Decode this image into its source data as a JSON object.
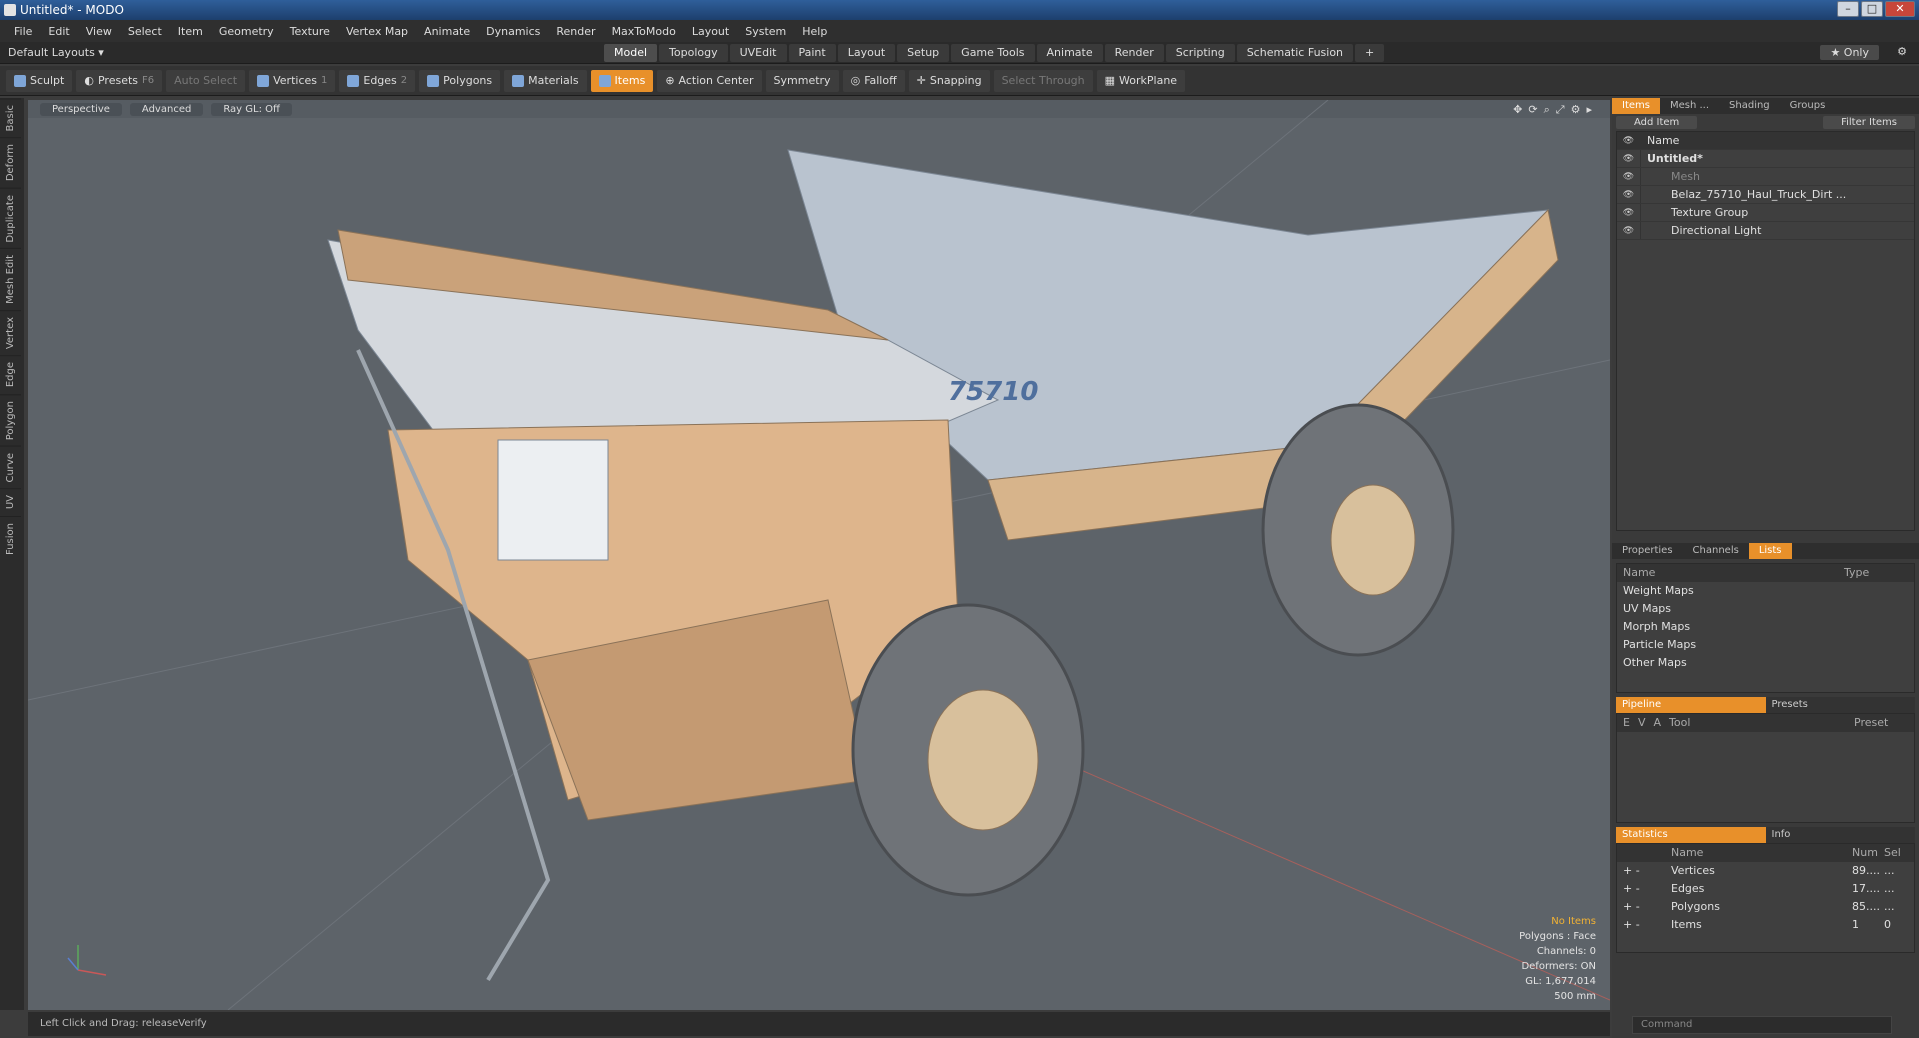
{
  "window": {
    "title": "Untitled* - MODO"
  },
  "menu": [
    "File",
    "Edit",
    "View",
    "Select",
    "Item",
    "Geometry",
    "Texture",
    "Vertex Map",
    "Animate",
    "Dynamics",
    "Render",
    "MaxToModo",
    "Layout",
    "System",
    "Help"
  ],
  "layout": {
    "selector": "Default Layouts ▾",
    "tabs": [
      "Model",
      "Topology",
      "UVEdit",
      "Paint",
      "Layout",
      "Setup",
      "Game Tools",
      "Animate",
      "Render",
      "Scripting",
      "Schematic Fusion"
    ],
    "active_tab": "Model",
    "only": "★ Only"
  },
  "toolbar": {
    "sculpt": "Sculpt",
    "presets": "Presets",
    "presets_key": "F6",
    "auto_select": "Auto Select",
    "vertices": "Vertices",
    "vertices_n": "1",
    "edges": "Edges",
    "edges_n": "2",
    "polygons": "Polygons",
    "materials": "Materials",
    "items": "Items",
    "action_center": "Action Center",
    "symmetry": "Symmetry",
    "falloff": "Falloff",
    "snapping": "Snapping",
    "select_through": "Select Through",
    "workplane": "WorkPlane"
  },
  "left_tabs": [
    "Basic",
    "Deform",
    "Duplicate",
    "Mesh Edit",
    "Vertex",
    "Edge",
    "Polygon",
    "Curve",
    "UV",
    "Fusion"
  ],
  "viewport": {
    "perspective": "Perspective",
    "advanced": "Advanced",
    "raygl": "Ray GL: Off",
    "truck_number": "75710",
    "stats": {
      "no_items": "No Items",
      "polygons": "Polygons : Face",
      "channels": "Channels: 0",
      "deformers": "Deformers: ON",
      "gl": "GL: 1,677,014",
      "scale": "500 mm"
    }
  },
  "status": {
    "hint": "Left Click and Drag:  releaseVerify"
  },
  "items_panel": {
    "tabs": [
      "Items",
      "Mesh ...",
      "Shading",
      "Groups"
    ],
    "add_item": "Add Item",
    "filter": "Filter Items",
    "col_name": "Name",
    "rows": [
      "Untitled*",
      "Mesh",
      "Belaz_75710_Haul_Truck_Dirt ...",
      "Texture Group",
      "Directional Light"
    ]
  },
  "props_panel": {
    "tabs": [
      "Properties",
      "Channels",
      "Lists"
    ],
    "col_name": "Name",
    "col_type": "Type",
    "rows": [
      "Weight Maps",
      "UV Maps",
      "Morph Maps",
      "Particle Maps",
      "Other Maps"
    ]
  },
  "pipeline": {
    "tabs": [
      "Pipeline",
      "Presets"
    ],
    "cols": [
      "E",
      "V",
      "A",
      "Tool",
      "Preset"
    ]
  },
  "statistics": {
    "tabs": [
      "Statistics",
      "Info"
    ],
    "cols": [
      "Name",
      "Num",
      "Sel"
    ],
    "rows": [
      {
        "name": "Vertices",
        "num": "89....",
        "sel": "..."
      },
      {
        "name": "Edges",
        "num": "17....",
        "sel": "..."
      },
      {
        "name": "Polygons",
        "num": "85....",
        "sel": "..."
      },
      {
        "name": "Items",
        "num": "1",
        "sel": "0"
      }
    ]
  },
  "command": {
    "placeholder": "Command"
  }
}
